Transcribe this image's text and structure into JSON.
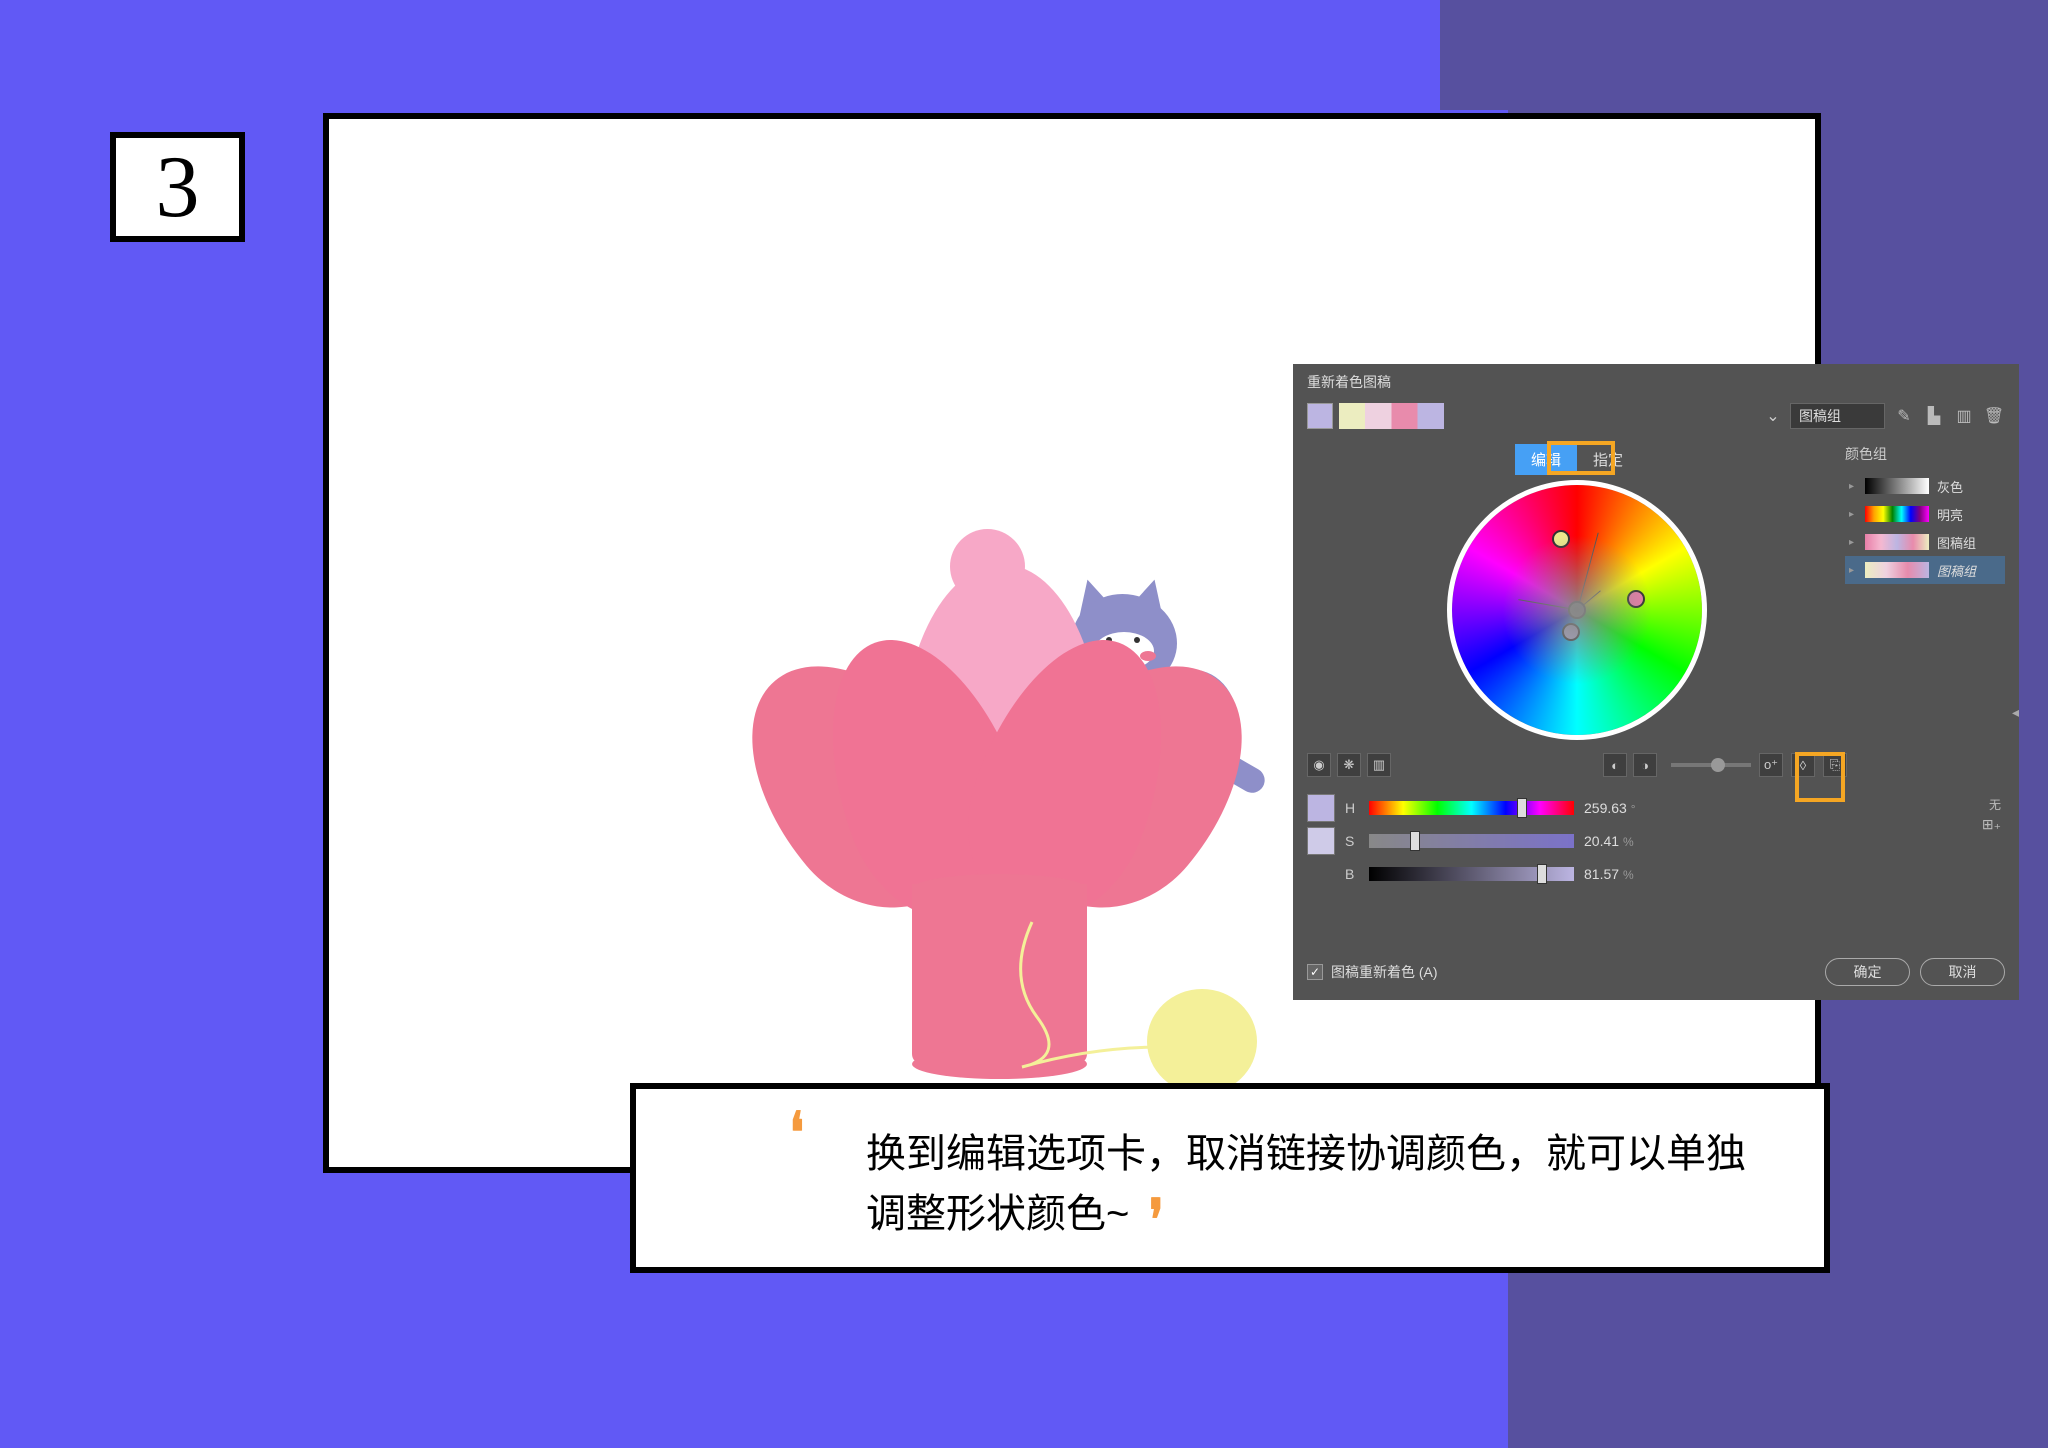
{
  "step_number": "3",
  "caption": "换到编辑选项卡，取消链接协调颜色，就可以单独调整形状颜色~",
  "panel": {
    "title": "重新着色图稿",
    "preset_label": "图稿组",
    "tabs": {
      "edit": "编辑",
      "assign": "指定"
    },
    "sidebar_title": "颜色组",
    "groups": {
      "gray": "灰色",
      "bright": "明亮",
      "art1": "图稿组",
      "art2": "图稿组"
    },
    "hsb": {
      "h_label": "H",
      "h_value": "259.63",
      "h_unit": "°",
      "s_label": "S",
      "s_value": "20.41",
      "s_unit": "%",
      "b_label": "B",
      "b_value": "81.57",
      "b_unit": "%"
    },
    "no_label": "无",
    "recolor_checkbox": "图稿重新着色 (A)",
    "ok": "确定",
    "cancel": "取消"
  }
}
